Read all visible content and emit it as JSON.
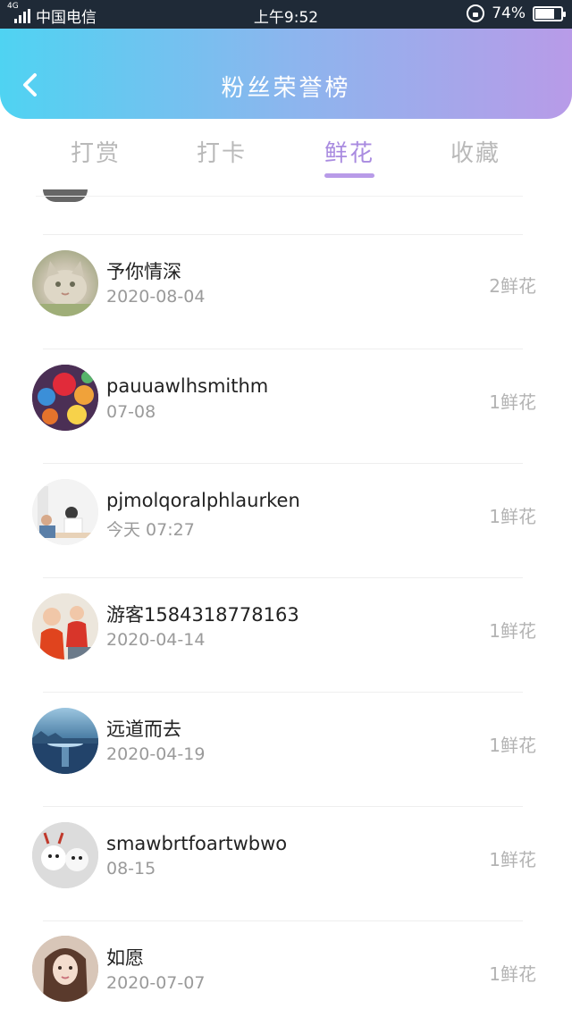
{
  "status_bar": {
    "network": "4G",
    "carrier": "中国电信",
    "time": "上午9:52",
    "battery": "74%",
    "battery_level": 0.74
  },
  "header": {
    "title": "粉丝荣誉榜",
    "back_icon": "chevron-left-icon"
  },
  "tabs": [
    {
      "label": "打赏",
      "active": false
    },
    {
      "label": "打卡",
      "active": false
    },
    {
      "label": "鲜花",
      "active": true
    },
    {
      "label": "收藏",
      "active": false
    }
  ],
  "rows": [
    {
      "name": "予你情深",
      "date": "2020-08-04",
      "count": "2鲜花"
    },
    {
      "name": "pauuawlhsmithm",
      "date": "07-08",
      "count": "1鲜花"
    },
    {
      "name": "pjmolqoralphlaurken",
      "date": "今天 07:27",
      "count": "1鲜花"
    },
    {
      "name": "游客1584318778163",
      "date": "2020-04-14",
      "count": "1鲜花"
    },
    {
      "name": "远道而去",
      "date": "2020-04-19",
      "count": "1鲜花"
    },
    {
      "name": "smawbrtfoartwbwo",
      "date": "08-15",
      "count": "1鲜花"
    },
    {
      "name": "如愿",
      "date": "2020-07-07",
      "count": "1鲜花"
    }
  ]
}
